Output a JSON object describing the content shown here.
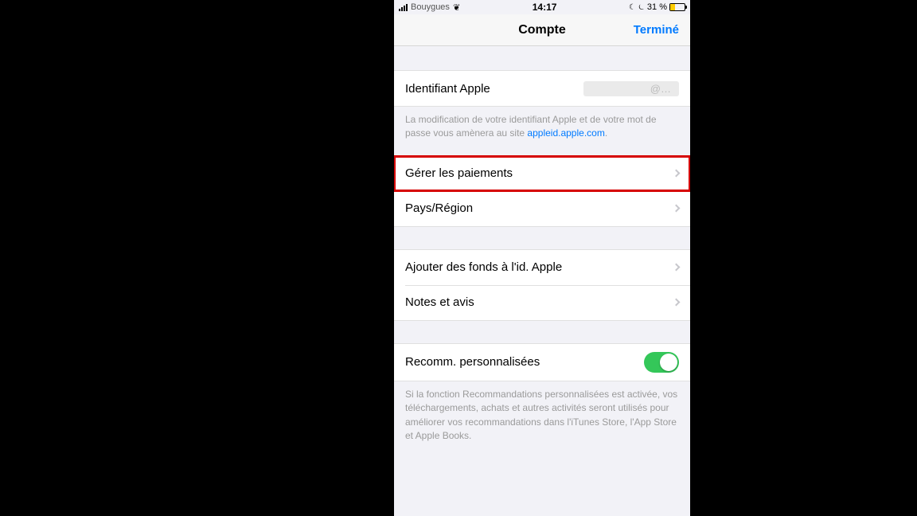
{
  "status": {
    "carrier": "Bouygues",
    "time": "14:17",
    "battery_percent": "31 %"
  },
  "nav": {
    "title": "Compte",
    "done": "Terminé"
  },
  "appleid": {
    "label": "Identifiant Apple",
    "value": "@…",
    "footer": "La modification de votre identifiant Apple et de votre mot de passe vous amènera au site ",
    "footer_link": "appleid.apple.com"
  },
  "rows": {
    "manage_payments": "Gérer les paiements",
    "country_region": "Pays/Région",
    "add_funds": "Ajouter des fonds à l'id. Apple",
    "notes_reviews": "Notes et avis",
    "personalized": "Recomm. personnalisées"
  },
  "personalized_footer": "Si la fonction Recommandations personnalisées est activée, vos téléchargements, achats et autres activités seront utilisés pour améliorer vos recommandations dans l'iTunes Store, l'App Store et Apple Books."
}
